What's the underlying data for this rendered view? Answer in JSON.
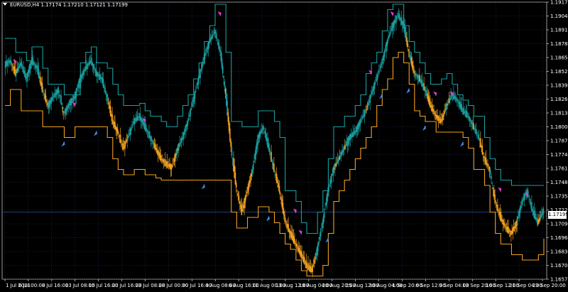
{
  "chart_header": {
    "symbol": "EURUSD,H4",
    "ohlc": "1.17174 1.17210 1.17121 1.17199"
  },
  "current_price": "1.17199",
  "colors": {
    "background": "#000000",
    "grid": "#2a3a5a",
    "bull_line": "#1a9e9e",
    "bear_line": "#f0a020",
    "buy_arrow": "#3d8de0",
    "sell_arrow": "#e040e0",
    "current_price_line": "#3050a0"
  },
  "chart_data": {
    "type": "candlestick",
    "symbol": "EURUSD",
    "timeframe": "H4",
    "ylim": [
      1.1657,
      1.1917
    ],
    "y_ticks": [
      "1.19170",
      "1.19040",
      "1.18910",
      "1.18780",
      "1.18650",
      "1.18520",
      "1.18390",
      "1.18260",
      "1.18130",
      "1.18000",
      "1.17870",
      "1.17740",
      "1.17610",
      "1.17480",
      "1.17350",
      "1.17220",
      "1.17090",
      "1.16960",
      "1.16830",
      "1.16700",
      "1.16570"
    ],
    "x_ticks": [
      "1 Jul 2021",
      "6 Jul 00:00",
      "8 Jul 16:00",
      "13 Jul 08:00",
      "15 Jul 16:00",
      "20 Jul 16:00",
      "23 Jul 08:00",
      "28 Jul 00:00",
      "30 Jul 16:00",
      "4 Aug 08:00",
      "6 Aug 16:00",
      "11 Aug 00:00",
      "13 Aug 12:00",
      "18 Aug 04:00",
      "20 Aug 20:00",
      "25 Aug 12:00",
      "30 Aug 04:00",
      "1 Sep 20:00",
      "6 Sep 12:00",
      "9 Sep 04:00",
      "13 Sep 20:00",
      "16 Sep 12:00",
      "21 Sep 04:00",
      "23 Sep 20:00"
    ],
    "close_series": [
      1.1858,
      1.1862,
      1.185,
      1.186,
      1.1845,
      1.1862,
      1.1855,
      1.1835,
      1.182,
      1.1828,
      1.1835,
      1.1812,
      1.1822,
      1.1828,
      1.1845,
      1.1855,
      1.1862,
      1.185,
      1.1845,
      1.1828,
      1.1805,
      1.1795,
      1.178,
      1.1792,
      1.1805,
      1.181,
      1.18,
      1.179,
      1.178,
      1.177,
      1.1765,
      1.1762,
      1.1778,
      1.179,
      1.1805,
      1.1825,
      1.1845,
      1.1865,
      1.188,
      1.189,
      1.187,
      1.183,
      1.178,
      1.1742,
      1.172,
      1.174,
      1.176,
      1.179,
      1.18,
      1.178,
      1.176,
      1.174,
      1.1712,
      1.17,
      1.169,
      1.168,
      1.167,
      1.1665,
      1.1685,
      1.171,
      1.174,
      1.176,
      1.177,
      1.178,
      1.179,
      1.1795,
      1.1805,
      1.1815,
      1.183,
      1.1845,
      1.186,
      1.188,
      1.1895,
      1.1905,
      1.1895,
      1.187,
      1.185,
      1.1845,
      1.1835,
      1.182,
      1.181,
      1.1805,
      1.182,
      1.183,
      1.1825,
      1.1815,
      1.181,
      1.18,
      1.179,
      1.177,
      1.176,
      1.173,
      1.1715,
      1.1705,
      1.17,
      1.171,
      1.173,
      1.174,
      1.172,
      1.171,
      1.1722
    ],
    "upper_band": [
      1.1883,
      1.1883,
      1.187,
      1.187,
      1.1862,
      1.1875,
      1.1875,
      1.1855,
      1.184,
      1.184,
      1.184,
      1.183,
      1.183,
      1.183,
      1.186,
      1.187,
      1.1875,
      1.186,
      1.186,
      1.1855,
      1.184,
      1.183,
      1.182,
      1.182,
      1.182,
      1.1822,
      1.1815,
      1.181,
      1.181,
      1.1805,
      1.18,
      1.18,
      1.181,
      1.182,
      1.183,
      1.1845,
      1.186,
      1.188,
      1.1895,
      1.1915,
      1.1915,
      1.187,
      1.1805,
      1.1805,
      1.18,
      1.18,
      1.18,
      1.1815,
      1.1815,
      1.1815,
      1.1805,
      1.179,
      1.174,
      1.174,
      1.173,
      1.171,
      1.17,
      1.17,
      1.172,
      1.174,
      1.177,
      1.18,
      1.18,
      1.181,
      1.181,
      1.182,
      1.183,
      1.185,
      1.186,
      1.187,
      1.189,
      1.191,
      1.1915,
      1.1915,
      1.1895,
      1.188,
      1.187,
      1.186,
      1.185,
      1.184,
      1.184,
      1.1845,
      1.185,
      1.184,
      1.183,
      1.1825,
      1.182,
      1.181,
      1.181,
      1.179,
      1.177,
      1.176,
      1.175,
      1.175,
      1.1745,
      1.1745,
      1.1745,
      1.1745,
      1.1745,
      1.1745,
      1.1745
    ],
    "lower_band": [
      1.182,
      1.1835,
      1.1835,
      1.1815,
      1.1815,
      1.1815,
      1.1815,
      1.18,
      1.18,
      1.18,
      1.18,
      1.179,
      1.179,
      1.18,
      1.18,
      1.18,
      1.18,
      1.18,
      1.18,
      1.179,
      1.177,
      1.176,
      1.1755,
      1.1755,
      1.176,
      1.176,
      1.1755,
      1.1755,
      1.1752,
      1.175,
      1.175,
      1.175,
      1.175,
      1.175,
      1.175,
      1.175,
      1.175,
      1.175,
      1.175,
      1.175,
      1.175,
      1.175,
      1.172,
      1.1705,
      1.1705,
      1.1715,
      1.1715,
      1.1725,
      1.1725,
      1.172,
      1.171,
      1.17,
      1.169,
      1.1685,
      1.1675,
      1.1665,
      1.166,
      1.166,
      1.166,
      1.167,
      1.17,
      1.173,
      1.174,
      1.175,
      1.176,
      1.177,
      1.178,
      1.179,
      1.18,
      1.182,
      1.1835,
      1.1845,
      1.1865,
      1.187,
      1.186,
      1.184,
      1.1815,
      1.181,
      1.1805,
      1.1805,
      1.1795,
      1.1795,
      1.1795,
      1.1795,
      1.1795,
      1.179,
      1.178,
      1.176,
      1.176,
      1.1745,
      1.172,
      1.17,
      1.169,
      1.169,
      1.168,
      1.168,
      1.1675,
      1.1675,
      1.1675,
      1.168,
      1.1695
    ],
    "buy_signals": [
      11,
      17,
      37,
      49,
      60,
      70,
      75,
      78,
      85
    ],
    "sell_signals": [
      2,
      13,
      26,
      40,
      54,
      55,
      68,
      72,
      80,
      83,
      92,
      97
    ]
  }
}
